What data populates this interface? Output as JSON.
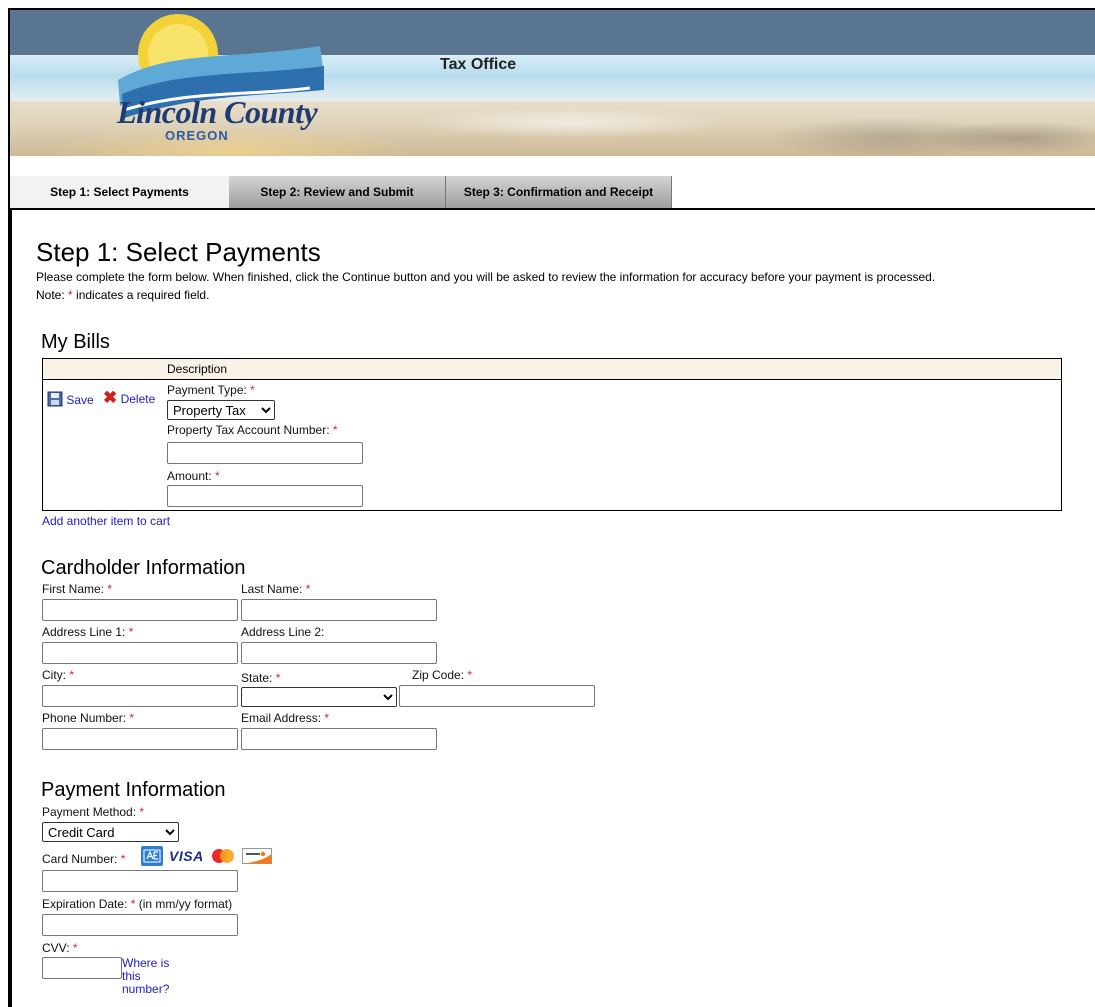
{
  "header": {
    "banner_title": "Tax Office",
    "logo_main": "Lincoln County",
    "logo_sub": "OREGON"
  },
  "tabs": [
    {
      "label": "Step 1: Select Payments",
      "active": true
    },
    {
      "label": "Step 2: Review and Submit",
      "active": false
    },
    {
      "label": "Step 3: Confirmation and Receipt",
      "active": false
    }
  ],
  "page": {
    "title": "Step 1: Select Payments",
    "intro": "Please complete the form below. When finished, click the Continue button and you will be asked to review the information for accuracy before your payment is processed.",
    "note_prefix": "Note: ",
    "note_star": "*",
    "note_suffix": " indicates a required field."
  },
  "bills": {
    "heading": "My Bills",
    "column_description": "Description",
    "save_label": "Save",
    "delete_label": "Delete",
    "payment_type_label": "Payment Type:",
    "payment_type_value": "Property Tax",
    "account_number_label": "Property Tax Account Number:",
    "amount_label": "Amount:",
    "add_item_label": "Add another item to cart"
  },
  "cardholder": {
    "heading": "Cardholder Information",
    "first_name": "First Name:",
    "last_name": "Last Name:",
    "address1": "Address Line 1:",
    "address2": "Address Line 2:",
    "city": "City:",
    "state": "State:",
    "zip": "Zip Code:",
    "phone": "Phone Number:",
    "email": "Email Address:"
  },
  "payment": {
    "heading": "Payment Information",
    "method_label": "Payment Method:",
    "method_value": "Credit Card",
    "card_number_label": "Card Number:",
    "card_logos": [
      "amex-icon",
      "visa-icon",
      "mastercard-icon",
      "discover-icon"
    ],
    "visa_text": "VISA",
    "expiration_label": "Expiration Date:",
    "expiration_hint": "(in mm/yy format)",
    "cvv_label": "CVV:",
    "cvv_help_label": "Where is this number?"
  },
  "required_star": "*",
  "colors": {
    "required": "#dd2222",
    "link": "#1a1ad0",
    "table_header": "#f8f3e6",
    "banner_top": "#5a7590"
  }
}
